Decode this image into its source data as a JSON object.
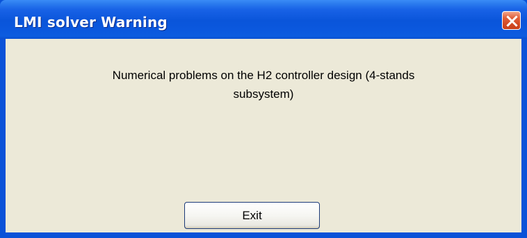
{
  "window": {
    "title": "LMI solver Warning",
    "close_icon": "close-icon"
  },
  "dialog": {
    "message_line1": "Numerical problems on the H2 controller design (4-stands",
    "message_line2": "subsystem)",
    "exit_label": "Exit"
  },
  "colors": {
    "titlebar": "#0a55da",
    "client_background": "#ece9d8",
    "close_button": "#d24a24",
    "button_border": "#1c3a78"
  }
}
